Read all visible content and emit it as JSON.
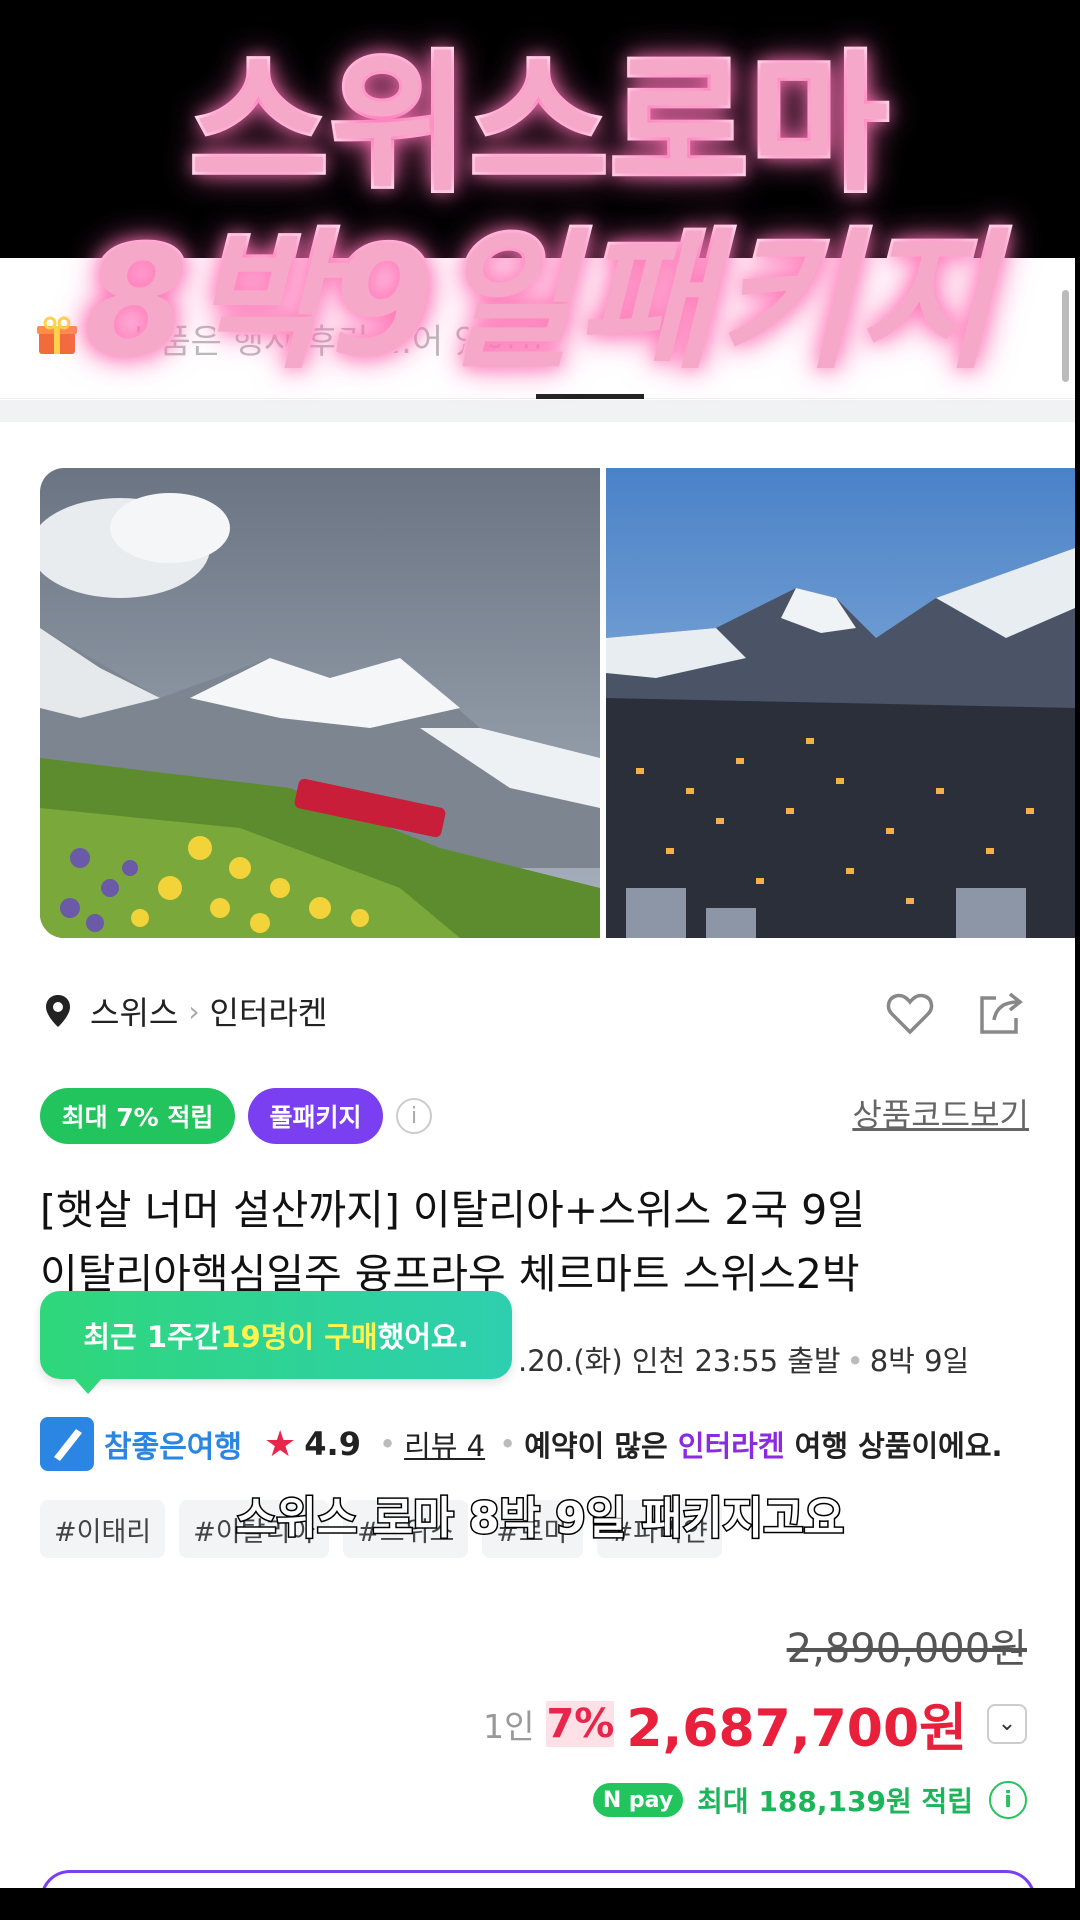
{
  "overlay": {
    "title_line1": "스위스로마",
    "title_line2": "8박9일패키지",
    "subtitle": "스위스 로마 8박 9일 패키지고요"
  },
  "notice": {
    "text": "이 상품은 행사 후기 ...어 있어요"
  },
  "location": {
    "country": "스위스",
    "city": "인터라켄"
  },
  "badges": {
    "points": "최대 7% 적립",
    "type": "풀패키지",
    "info": "i"
  },
  "code_link": "상품코드보기",
  "product": {
    "title_line1": "[햇살 너머 설산까지] 이탈리아+스위스 2국 9일",
    "title_line2": "이탈리아핵심일주 융프라우 체르마트 스위스2박",
    "departure": ".20.(화) 인천 23:55 출발",
    "duration": "8박 9일"
  },
  "tooltip": {
    "prefix": "최근 1주간 ",
    "highlight": "19명이 구매",
    "suffix": "했어요."
  },
  "agency": {
    "name": "참좋은여행",
    "rating": "4.9",
    "review": "리뷰 4",
    "msg_prefix": "예약이 많은 ",
    "msg_city": "인터라켄",
    "msg_suffix": " 여행 상품이에요."
  },
  "tags": [
    "#이태리",
    "#이탈리아",
    "#스위스",
    "#로마",
    "#파리얀"
  ],
  "price": {
    "original": "2,890,000원",
    "per": "1인",
    "discount": "7%",
    "final": "2,687,700원",
    "npay_label": "N pay",
    "npay_points": "최대 188,139원 적립"
  },
  "colors": {
    "green": "#21c45d",
    "purple": "#7b3ff2",
    "red": "#e8203b",
    "headline_pink": "#f5a8c8"
  },
  "icons": [
    "gift-icon",
    "pin-icon",
    "chevron-right-icon",
    "heart-icon",
    "share-icon",
    "info-icon",
    "star-icon",
    "chevron-down-icon"
  ]
}
